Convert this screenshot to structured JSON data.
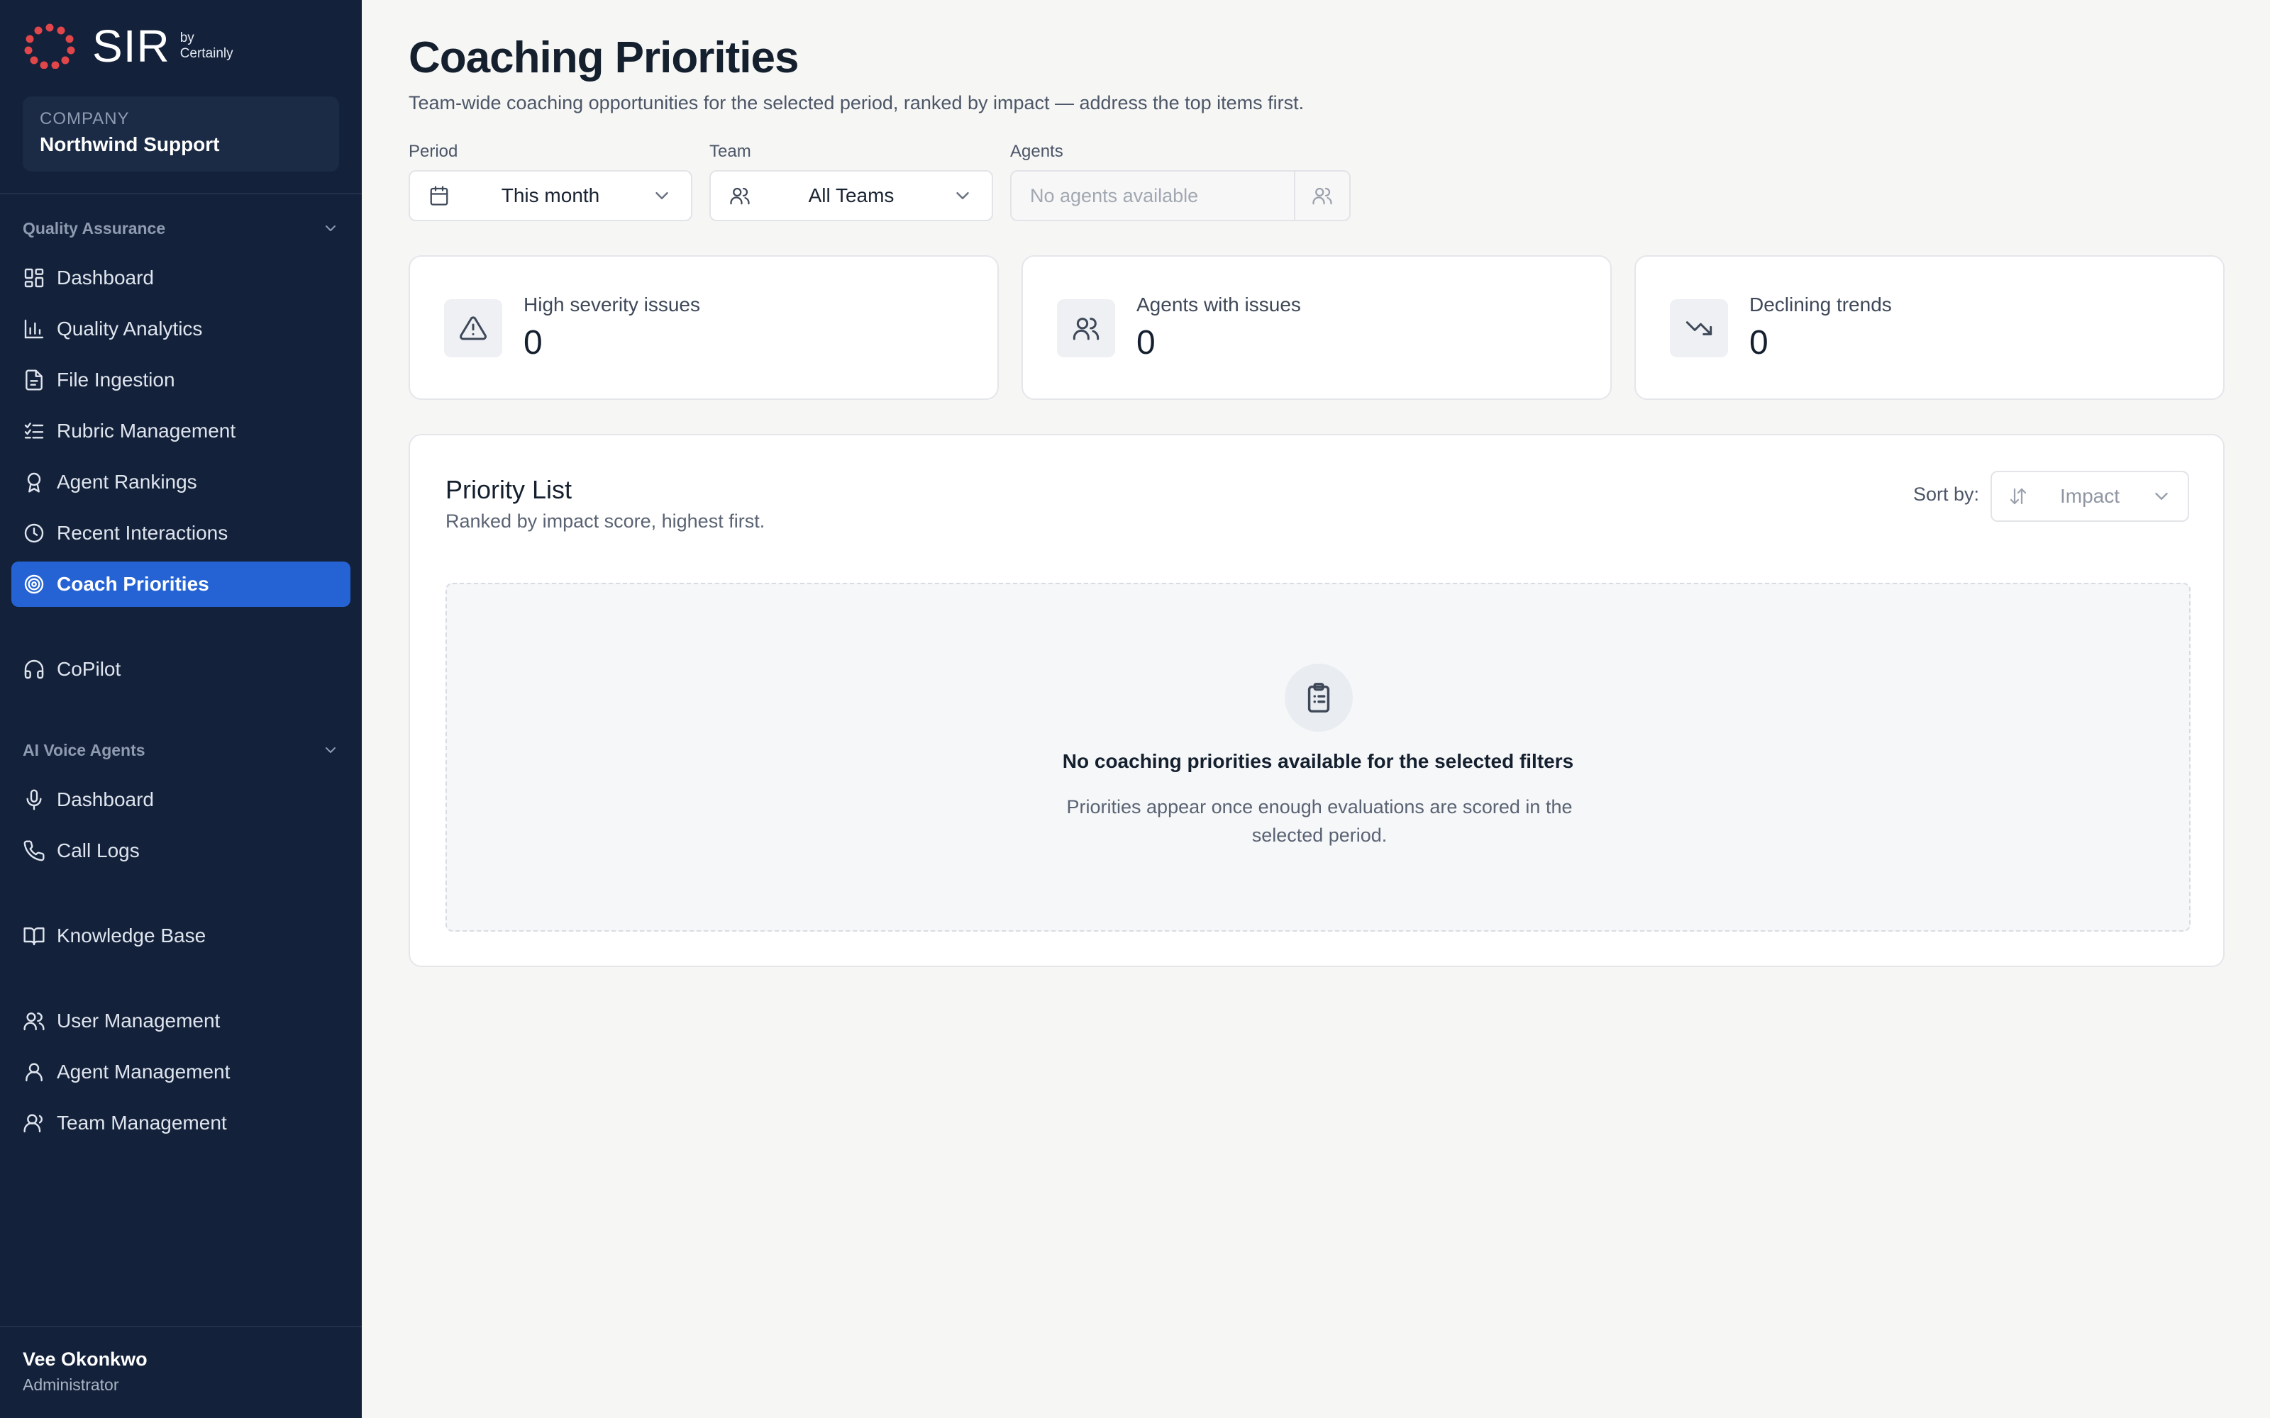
{
  "brand": {
    "name": "SIR",
    "by_line1": "by",
    "by_line2": "Certainly",
    "logo_color": "#e0464a"
  },
  "company": {
    "label": "COMPANY",
    "name": "Northwind Support"
  },
  "sidebar": {
    "sections": {
      "quality_assurance": "Quality Assurance",
      "ai_voice_agents": "AI Voice Agents"
    },
    "qa_items": [
      {
        "label": "Dashboard",
        "icon": "dashboard-icon"
      },
      {
        "label": "Quality Analytics",
        "icon": "bar-chart-icon"
      },
      {
        "label": "File Ingestion",
        "icon": "file-icon"
      },
      {
        "label": "Rubric Management",
        "icon": "checklist-icon"
      },
      {
        "label": "Agent Rankings",
        "icon": "award-icon"
      },
      {
        "label": "Recent Interactions",
        "icon": "clock-icon"
      },
      {
        "label": "Coach Priorities",
        "icon": "target-icon",
        "active": true
      }
    ],
    "copilot": {
      "label": "CoPilot",
      "icon": "headphones-icon"
    },
    "voice_items": [
      {
        "label": "Dashboard",
        "icon": "microphone-icon"
      },
      {
        "label": "Call Logs",
        "icon": "phone-icon"
      }
    ],
    "knowledge_base": {
      "label": "Knowledge Base",
      "icon": "book-icon"
    },
    "admin_items": [
      {
        "label": "User Management",
        "icon": "users-icon"
      },
      {
        "label": "Agent Management",
        "icon": "user-icon"
      },
      {
        "label": "Team Management",
        "icon": "team-icon"
      }
    ],
    "active_color": "#2563d4",
    "background": "#13213a"
  },
  "user": {
    "name": "Vee Okonkwo",
    "role": "Administrator"
  },
  "main": {
    "title": "Coaching Priorities",
    "subtitle": "Team-wide coaching opportunities for the selected period, ranked by impact — address the top items first.",
    "filters": {
      "period": {
        "label": "Period",
        "value": "This month"
      },
      "team": {
        "label": "Team",
        "value": "All Teams"
      },
      "agents": {
        "label": "Agents",
        "placeholder": "No agents available"
      }
    },
    "stats": [
      {
        "label": "High severity issues",
        "value": "0",
        "icon": "alert-triangle-icon"
      },
      {
        "label": "Agents with issues",
        "value": "0",
        "icon": "users-icon"
      },
      {
        "label": "Declining trends",
        "value": "0",
        "icon": "trending-down-icon"
      }
    ],
    "priority_list": {
      "title": "Priority List",
      "subtitle": "Ranked by impact score, highest first.",
      "sort_label": "Sort by:",
      "sort_value": "Impact",
      "empty_title": "No coaching priorities available for the selected filters",
      "empty_desc": "Priorities appear once enough evaluations are scored in the selected period."
    }
  }
}
